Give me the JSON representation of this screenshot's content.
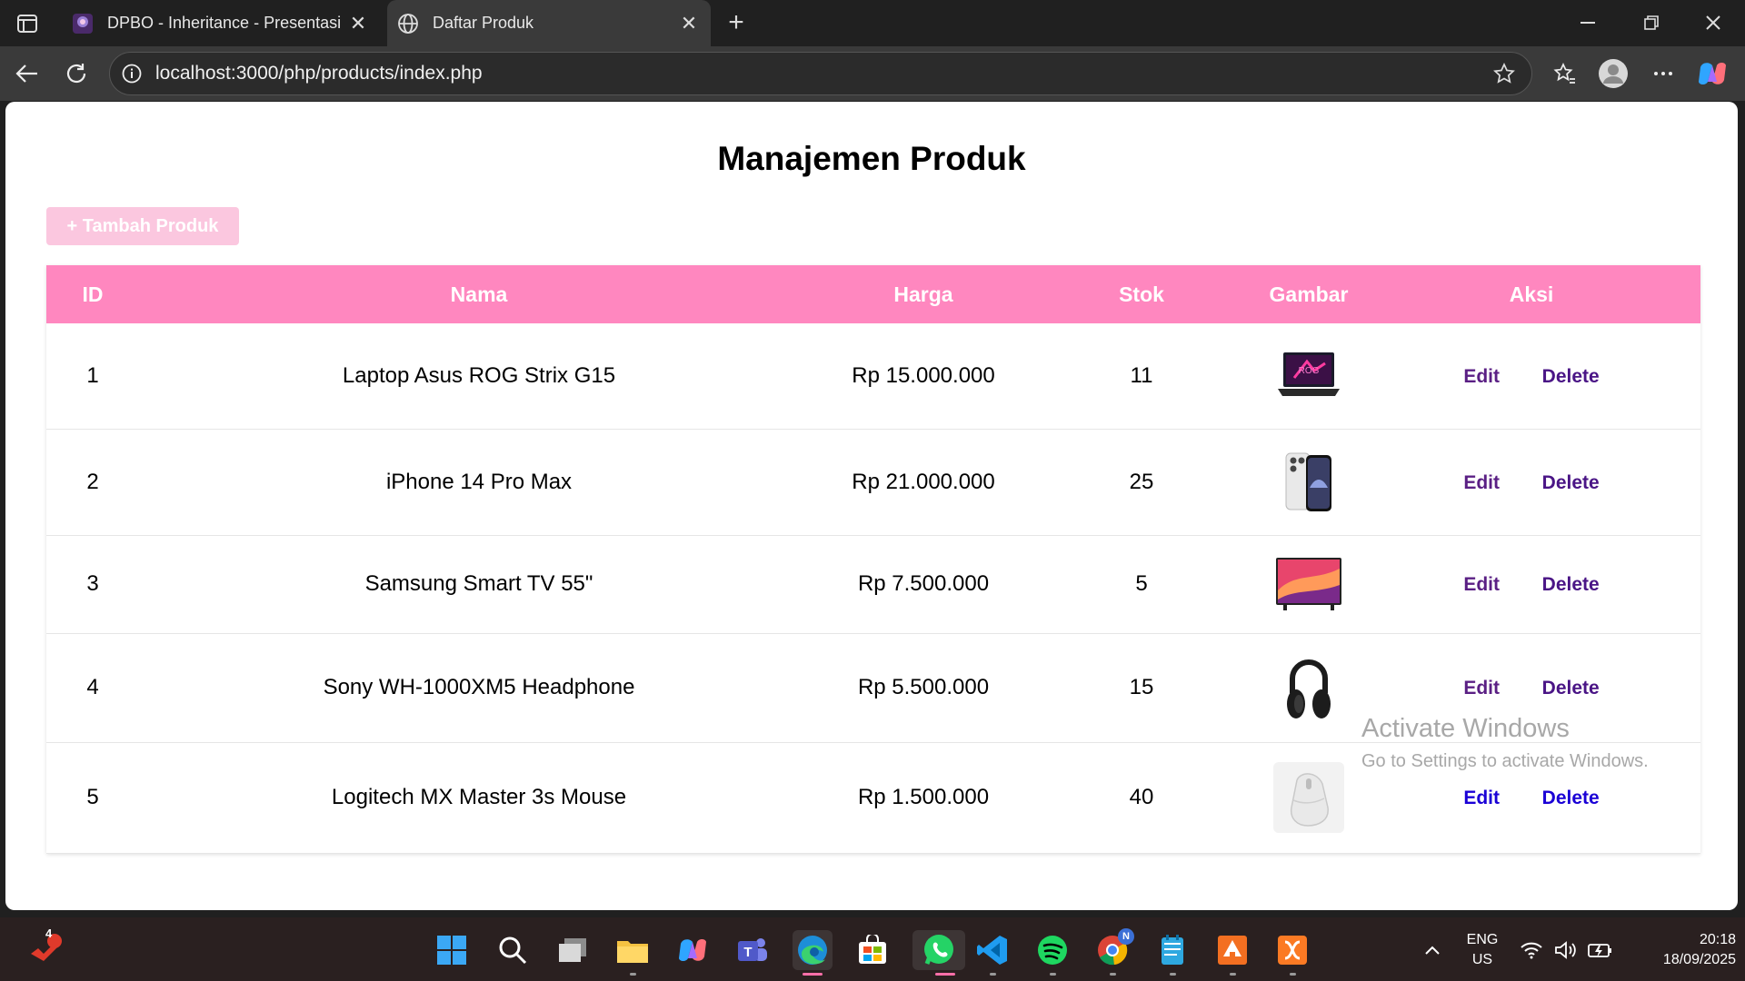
{
  "browser": {
    "tabs": [
      {
        "title": "DPBO - Inheritance - Presentasi",
        "active": false
      },
      {
        "title": "Daftar Produk",
        "active": true
      }
    ],
    "url": "localhost:3000/php/products/index.php"
  },
  "page": {
    "title": "Manajemen Produk",
    "add_button": "+ Tambah Produk",
    "columns": [
      "ID",
      "Nama",
      "Harga",
      "Stok",
      "Gambar",
      "Aksi"
    ],
    "products": [
      {
        "id": "1",
        "name": "Laptop Asus ROG Strix G15",
        "price": "Rp 15.000.000",
        "stock": "11",
        "image": "laptop-icon"
      },
      {
        "id": "2",
        "name": "iPhone 14 Pro Max",
        "price": "Rp 21.000.000",
        "stock": "25",
        "image": "phone-icon"
      },
      {
        "id": "3",
        "name": "Samsung Smart TV 55\"",
        "price": "Rp 7.500.000",
        "stock": "5",
        "image": "tv-icon"
      },
      {
        "id": "4",
        "name": "Sony WH-1000XM5 Headphone",
        "price": "Rp 5.500.000",
        "stock": "15",
        "image": "headphone-icon"
      },
      {
        "id": "5",
        "name": "Logitech MX Master 3s Mouse",
        "price": "Rp 1.500.000",
        "stock": "40",
        "image": "mouse-icon"
      }
    ],
    "edit_label": "Edit",
    "delete_label": "Delete"
  },
  "watermark": {
    "line1": "Activate Windows",
    "line2": "Go to Settings to activate Windows."
  },
  "taskbar": {
    "badge": "4",
    "lang": "ENG",
    "region": "US",
    "time": "20:18",
    "date": "18/09/2025",
    "chrome_badge": "N"
  },
  "colors": {
    "header": "#ff87bf",
    "add_button": "#fbc7df",
    "edit": "#5a1f84",
    "delete": "#4a1586"
  }
}
